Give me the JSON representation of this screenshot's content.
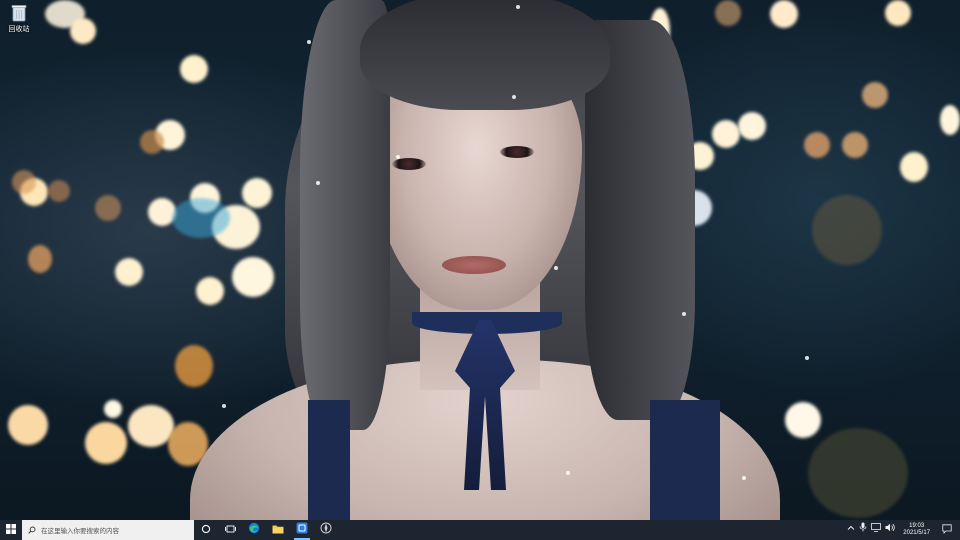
{
  "desktop": {
    "wallpaper": "anime-girl-bokeh-wallpaper",
    "icons": [
      {
        "label": "回收站",
        "icon": "recycle-bin-icon"
      }
    ]
  },
  "taskbar": {
    "start_icon": "windows-start-icon",
    "search": {
      "icon": "search-icon",
      "placeholder": "在这里输入你要搜索的内容"
    },
    "pinned": [
      {
        "name": "cortana",
        "icon": "cortana-circle-icon",
        "active": false
      },
      {
        "name": "task-view",
        "icon": "task-view-icon",
        "active": false
      },
      {
        "name": "edge",
        "icon": "edge-browser-icon",
        "active": false
      },
      {
        "name": "file-explorer",
        "icon": "folder-icon",
        "active": false
      },
      {
        "name": "app-blue",
        "icon": "blue-app-icon",
        "active": true
      },
      {
        "name": "app-circle",
        "icon": "circle-app-icon",
        "active": false
      }
    ],
    "tray": {
      "icons": [
        "chevron-up-icon",
        "microphone-icon",
        "network-icon",
        "volume-icon"
      ],
      "time": "19:03",
      "date": "2021/5/17"
    },
    "notification_icon": "notification-icon"
  },
  "colors": {
    "taskbar_bg": "#1c2530",
    "search_bg": "#f0f0f0",
    "accent": "#8cc2f0"
  }
}
